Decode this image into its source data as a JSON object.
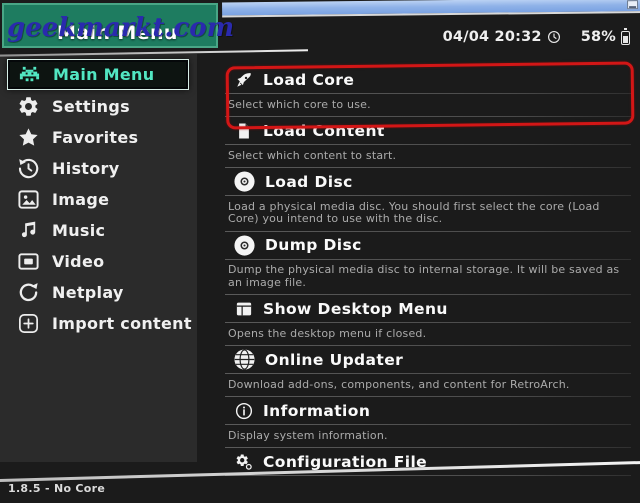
{
  "watermark": {
    "text": "geekmarkt.com"
  },
  "os_window": {
    "minimize_icon": "minimize"
  },
  "header": {
    "title": "Main Menu",
    "datetime": "04/04 20:32",
    "clock_icon": "clock",
    "battery_percent": "58%",
    "battery_icon": "battery"
  },
  "sidebar": {
    "items": [
      {
        "label": "Main Menu",
        "icon": "invader",
        "active": true
      },
      {
        "label": "Settings",
        "icon": "gear",
        "active": false
      },
      {
        "label": "Favorites",
        "icon": "star",
        "active": false
      },
      {
        "label": "History",
        "icon": "history",
        "active": false
      },
      {
        "label": "Image",
        "icon": "image",
        "active": false
      },
      {
        "label": "Music",
        "icon": "music",
        "active": false
      },
      {
        "label": "Video",
        "icon": "video",
        "active": false
      },
      {
        "label": "Netplay",
        "icon": "netplay",
        "active": false
      },
      {
        "label": "Import content",
        "icon": "plus-box",
        "active": false
      }
    ]
  },
  "main": {
    "entries": [
      {
        "label": "Load Core",
        "icon": "rocket",
        "annotated": true,
        "desc": "Select which core to use."
      },
      {
        "label": "Load Content",
        "icon": "file",
        "annotated": false,
        "desc": "Select which content to start."
      },
      {
        "label": "Load Disc",
        "icon": "disc",
        "annotated": false,
        "desc": "Load a physical media disc. You should first select the core (Load Core)  you intend to use with the disc."
      },
      {
        "label": "Dump Disc",
        "icon": "disc",
        "annotated": false,
        "desc": "Dump the physical media disc to internal storage. It will be saved as an image file."
      },
      {
        "label": "Show Desktop Menu",
        "icon": "desktop-window",
        "annotated": false,
        "desc": "Opens the desktop menu if closed."
      },
      {
        "label": "Online Updater",
        "icon": "globe",
        "annotated": false,
        "desc": "Download add-ons, components, and content for RetroArch."
      },
      {
        "label": "Information",
        "icon": "info",
        "annotated": false,
        "desc": "Display system information."
      },
      {
        "label": "Configuration File",
        "icon": "config-gears",
        "annotated": false,
        "desc": ""
      }
    ]
  },
  "footer": {
    "version": "1.8.5 - No Core"
  },
  "colors": {
    "accent_teal": "#52e6c2",
    "annotation_red": "#d31616",
    "watermark_green": "#1e7c60",
    "watermark_blue": "#2a2aae",
    "sidebar_bg": "#2b2b2b",
    "app_bg": "#1b1b1b"
  }
}
